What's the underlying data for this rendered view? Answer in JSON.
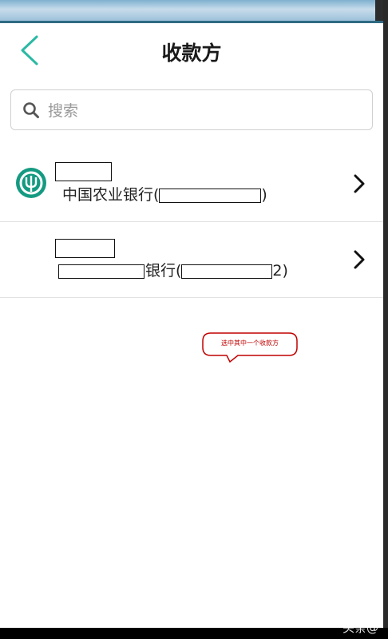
{
  "header": {
    "title": "收款方",
    "back_icon": "chevron-left-icon",
    "accent_color": "#2bb9a4"
  },
  "search": {
    "placeholder": "搜索",
    "value": ""
  },
  "payees": [
    {
      "bank_prefix": "中国农业银行(",
      "bank_suffix": ")",
      "logo_icon": "abc-bank-logo",
      "logo_color": "#159a82"
    },
    {
      "bank_prefix": "银行(",
      "bank_suffix": "2)"
    }
  ],
  "annotation": {
    "text": "选中其中一个收款方",
    "color": "#c00000"
  },
  "watermark": "头条@"
}
